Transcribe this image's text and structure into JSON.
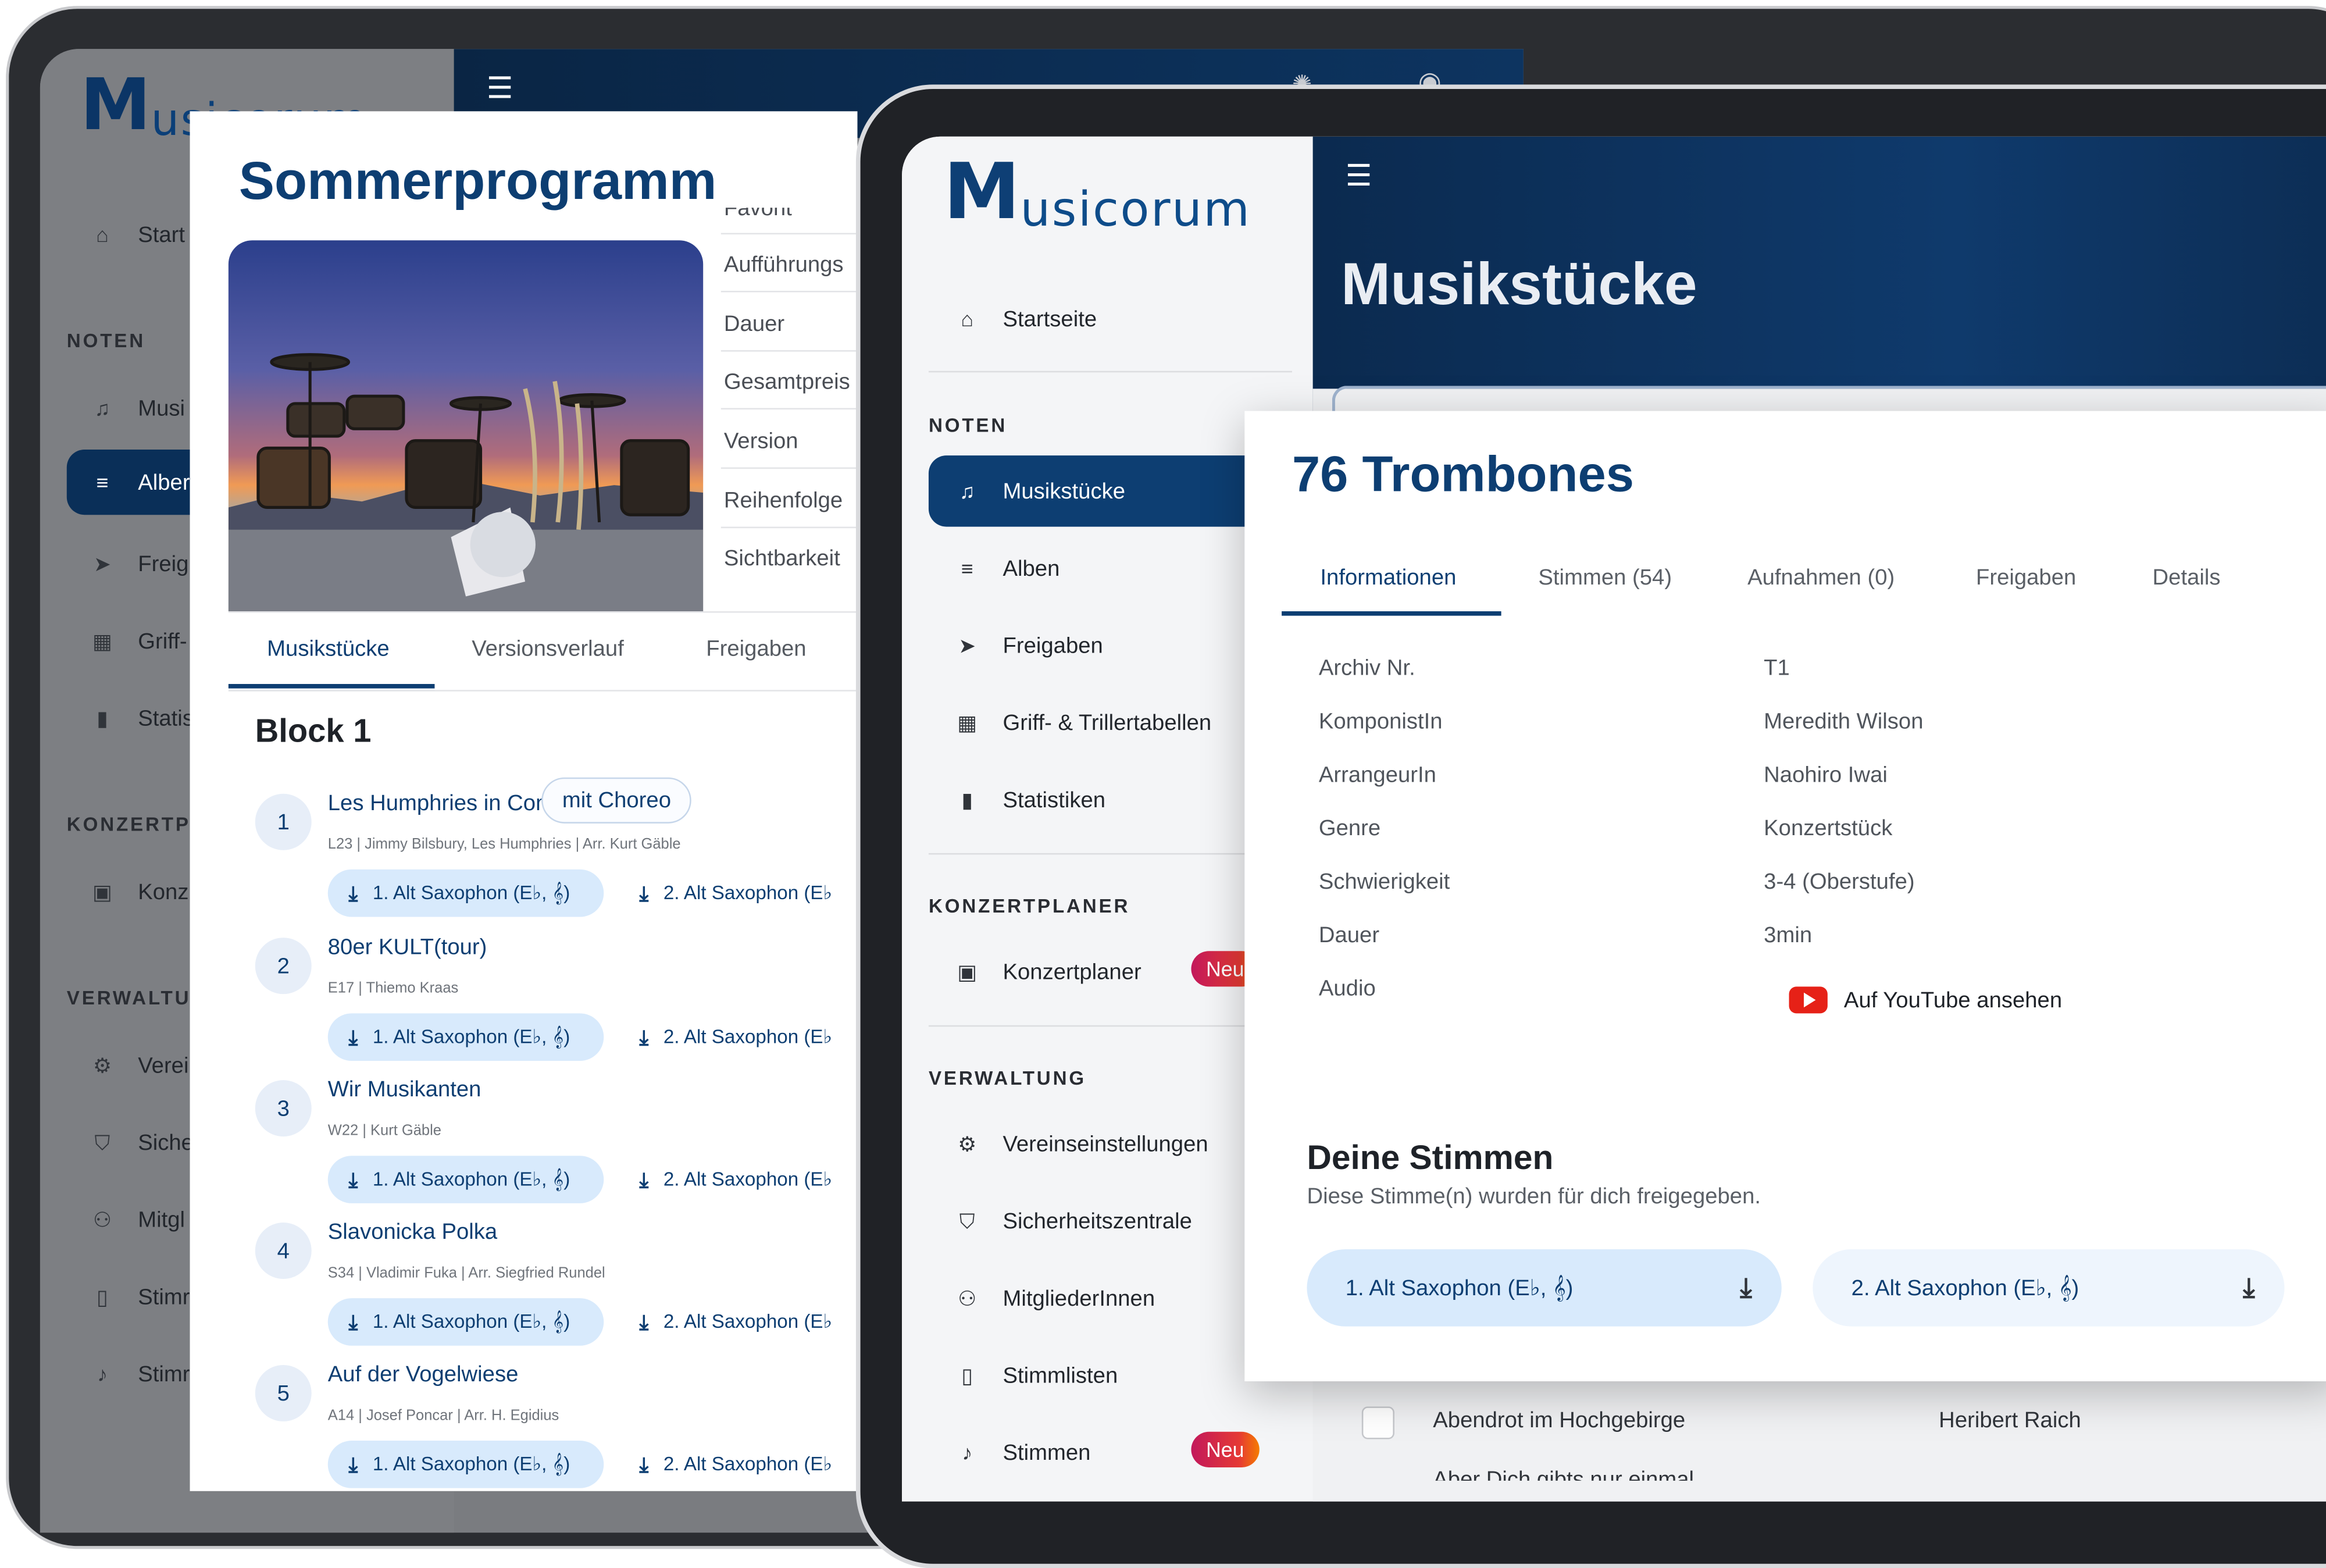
{
  "brand": {
    "logo_text": "usicorum",
    "logo_mark": "M"
  },
  "back_device": {
    "sidebar": {
      "items_top": [
        {
          "label": "Start",
          "icon": "home-icon"
        }
      ],
      "sections": [
        {
          "title": "NOTEN",
          "items": [
            {
              "label": "Musi",
              "icon": "music-note-icon"
            },
            {
              "label": "Alber",
              "icon": "album-icon",
              "active": true
            },
            {
              "label": "Freig",
              "icon": "send-icon"
            },
            {
              "label": "Griff-",
              "icon": "table-icon"
            },
            {
              "label": "Statis",
              "icon": "chart-icon"
            }
          ]
        },
        {
          "title": "KONZERTPL",
          "items": [
            {
              "label": "Konz",
              "icon": "calendar-icon"
            }
          ]
        },
        {
          "title": "VERWALTUN",
          "items": [
            {
              "label": "Verei",
              "icon": "gear-icon"
            },
            {
              "label": "Siche",
              "icon": "shield-icon"
            },
            {
              "label": "Mitgl",
              "icon": "users-icon"
            },
            {
              "label": "Stimr",
              "icon": "file-music-icon"
            },
            {
              "label": "Stimr",
              "icon": "note-icon"
            }
          ]
        }
      ]
    },
    "modal": {
      "title": "Sommerprogramm",
      "side_labels": [
        "Favorit",
        "Aufführungs",
        "Dauer",
        "Gesamtpreis",
        "Version",
        "Reihenfolge",
        "Sichtbarkeit"
      ],
      "tabs": [
        "Musikstücke",
        "Versionsverlauf",
        "Freigaben"
      ],
      "active_tab": 0,
      "block_title": "Block 1",
      "songs": [
        {
          "num": "1",
          "title": "Les Humphries in Concert",
          "meta": "L23 | Jimmy Bilsbury, Les Humphries | Arr. Kurt Gäble",
          "chip": "mit Choreo",
          "dl1": "1. Alt Saxophon (E♭, 𝄞)",
          "dl2": "2. Alt Saxophon (E♭"
        },
        {
          "num": "2",
          "title": "80er KULT(tour)",
          "meta": "E17 | Thiemo Kraas",
          "chip": "",
          "dl1": "1. Alt Saxophon (E♭, 𝄞)",
          "dl2": "2. Alt Saxophon (E♭"
        },
        {
          "num": "3",
          "title": "Wir Musikanten",
          "meta": "W22 | Kurt Gäble",
          "chip": "",
          "dl1": "1. Alt Saxophon (E♭, 𝄞)",
          "dl2": "2. Alt Saxophon (E♭"
        },
        {
          "num": "4",
          "title": "Slavonicka Polka",
          "meta": "S34 | Vladimir Fuka | Arr. Siegfried Rundel",
          "chip": "",
          "dl1": "1. Alt Saxophon (E♭, 𝄞)",
          "dl2": "2. Alt Saxophon (E♭"
        },
        {
          "num": "5",
          "title": "Auf der Vogelwiese",
          "meta": "A14 | Josef Poncar | Arr. H. Egidius",
          "chip": "",
          "dl1": "1. Alt Saxophon (E♭, 𝄞)",
          "dl2": "2. Alt Saxophon (E♭"
        }
      ]
    }
  },
  "front_device": {
    "sidebar": {
      "items_top": [
        {
          "label": "Startseite",
          "icon": "home-icon"
        }
      ],
      "sections": [
        {
          "title": "NOTEN",
          "items": [
            {
              "label": "Musikstücke",
              "icon": "music-note-icon",
              "active": true
            },
            {
              "label": "Alben",
              "icon": "album-icon"
            },
            {
              "label": "Freigaben",
              "icon": "send-icon"
            },
            {
              "label": "Griff- & Trillertabellen",
              "icon": "table-icon"
            },
            {
              "label": "Statistiken",
              "icon": "chart-icon"
            }
          ]
        },
        {
          "title": "KONZERTPLANER",
          "items": [
            {
              "label": "Konzertplaner",
              "icon": "calendar-icon",
              "badge": "Neu"
            }
          ]
        },
        {
          "title": "VERWALTUNG",
          "items": [
            {
              "label": "Vereinseinstellungen",
              "icon": "gear-icon"
            },
            {
              "label": "Sicherheitszentrale",
              "icon": "shield-icon"
            },
            {
              "label": "MitgliederInnen",
              "icon": "users-icon"
            },
            {
              "label": "Stimmlisten",
              "icon": "file-music-icon"
            },
            {
              "label": "Stimmen",
              "icon": "note-icon",
              "badge": "Neu"
            }
          ]
        }
      ]
    },
    "page_title": "Musikstücke",
    "list_rows": [
      {
        "title": "Abendrot im Hochgebirge",
        "composer": "Heribert Raich"
      },
      {
        "title": "Aber Dich gibts nur einmal",
        "composer": ""
      }
    ],
    "modal": {
      "title": "76 Trombones",
      "tabs": [
        "Informationen",
        "Stimmen (54)",
        "Aufnahmen (0)",
        "Freigaben",
        "Details"
      ],
      "active_tab": 0,
      "info": [
        {
          "label": "Archiv Nr.",
          "value": "T1"
        },
        {
          "label": "KomponistIn",
          "value": "Meredith Wilson"
        },
        {
          "label": "ArrangeurIn",
          "value": "Naohiro Iwai"
        },
        {
          "label": "Genre",
          "value": "Konzertstück"
        },
        {
          "label": "Schwierigkeit",
          "value": "3-4 (Oberstufe)"
        },
        {
          "label": "Dauer",
          "value": "3min"
        },
        {
          "label": "Audio",
          "value": ""
        }
      ],
      "youtube_label": "Auf YouTube ansehen",
      "stimmen_title": "Deine Stimmen",
      "stimmen_subtitle": "Diese Stimme(n) wurden für dich freigegeben.",
      "voices": [
        "1. Alt Saxophon (E♭, 𝄞)",
        "2. Alt Saxophon (E♭, 𝄞)"
      ]
    }
  }
}
